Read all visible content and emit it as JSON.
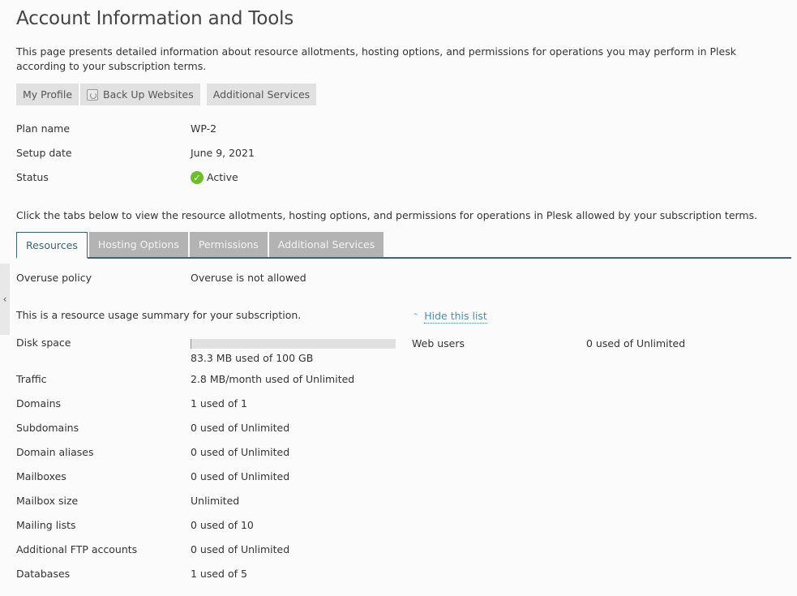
{
  "page": {
    "title": "Account Information and Tools",
    "intro": "This page presents detailed information about resource allotments, hosting options, and permissions for operations you may perform in Plesk according to your subscription terms."
  },
  "toolbar": {
    "my_profile": "My Profile",
    "back_up_websites": "Back Up Websites",
    "additional_services": "Additional Services"
  },
  "subscription": {
    "plan_name_label": "Plan name",
    "plan_name": "WP-2",
    "setup_date_label": "Setup date",
    "setup_date": "June 9, 2021",
    "status_label": "Status",
    "status": "Active",
    "status_color": "#6cbf2b"
  },
  "tabs_intro": "Click the tabs below to view the resource allotments, hosting options, and permissions for operations in Plesk allowed by your subscription terms.",
  "tabs": [
    {
      "label": "Resources",
      "active": true
    },
    {
      "label": "Hosting Options",
      "active": false
    },
    {
      "label": "Permissions",
      "active": false
    },
    {
      "label": "Additional Services",
      "active": false
    }
  ],
  "resources": {
    "overuse_label": "Overuse policy",
    "overuse_value": "Overuse is not allowed",
    "summary_text": "This is a resource usage summary for your subscription.",
    "hide_link": "Hide this list",
    "disk_label": "Disk space",
    "disk_value": "83.3 MB used of 100 GB",
    "disk_usage_percent": 0.08,
    "web_users_label": "Web users",
    "web_users_value": "0 used of Unlimited",
    "rows": [
      {
        "label": "Traffic",
        "value": "2.8 MB/month used of Unlimited"
      },
      {
        "label": "Domains",
        "value": "1 used of 1"
      },
      {
        "label": "Subdomains",
        "value": "0 used of Unlimited"
      },
      {
        "label": "Domain aliases",
        "value": "0 used of Unlimited"
      },
      {
        "label": "Mailboxes",
        "value": "0 used of Unlimited"
      },
      {
        "label": "Mailbox size",
        "value": "Unlimited"
      },
      {
        "label": "Mailing lists",
        "value": "0 used of 10"
      },
      {
        "label": "Additional FTP accounts",
        "value": "0 used of Unlimited"
      },
      {
        "label": "Databases",
        "value": "1 used of 5"
      }
    ]
  },
  "colors": {
    "accent": "#3d6273",
    "link": "#4c8fb0",
    "tab_inactive": "#b3b3b3",
    "button_bg": "#e1e1e1"
  }
}
